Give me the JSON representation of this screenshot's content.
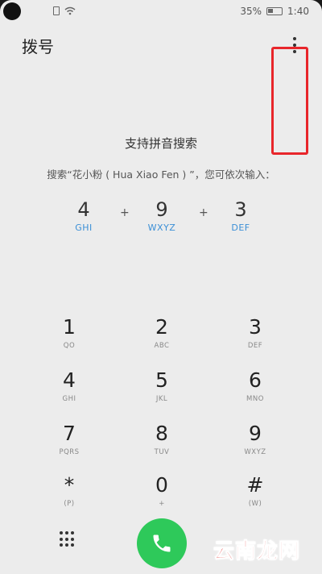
{
  "status_bar": {
    "battery_percent": "35%",
    "time": "1:40",
    "icons": [
      "camera-hole",
      "sim-icon",
      "wifi-icon",
      "battery-icon"
    ]
  },
  "app_bar": {
    "title": "拨号",
    "more_icon": "more-vert-icon"
  },
  "hint": {
    "title": "支持拼音搜索",
    "description": "搜索“花小粉 ( Hua Xiao Fen ) ”，您可依次输入："
  },
  "example": {
    "keys": [
      {
        "digit": "4",
        "letters": "GHI"
      },
      {
        "digit": "9",
        "letters": "WXYZ"
      },
      {
        "digit": "3",
        "letters": "DEF"
      }
    ],
    "separator": "+"
  },
  "keypad": {
    "keys": [
      {
        "digit": "1",
        "letters": "QO"
      },
      {
        "digit": "2",
        "letters": "ABC"
      },
      {
        "digit": "3",
        "letters": "DEF"
      },
      {
        "digit": "4",
        "letters": "GHI"
      },
      {
        "digit": "5",
        "letters": "JKL"
      },
      {
        "digit": "6",
        "letters": "MNO"
      },
      {
        "digit": "7",
        "letters": "PQRS"
      },
      {
        "digit": "8",
        "letters": "TUV"
      },
      {
        "digit": "9",
        "letters": "WXYZ"
      },
      {
        "digit": "*",
        "letters": "(P)"
      },
      {
        "digit": "0",
        "letters": "+"
      },
      {
        "digit": "#",
        "letters": "(W)"
      }
    ]
  },
  "bottom_bar": {
    "dialpad_icon": "dialpad-icon",
    "call_icon": "phone-icon"
  },
  "watermark": {
    "text": "云南龙网"
  },
  "colors": {
    "accent_blue": "#3b8fd6",
    "call_green": "#2ec95a",
    "highlight_red": "#e8262b",
    "watermark_red": "#e0211e"
  }
}
